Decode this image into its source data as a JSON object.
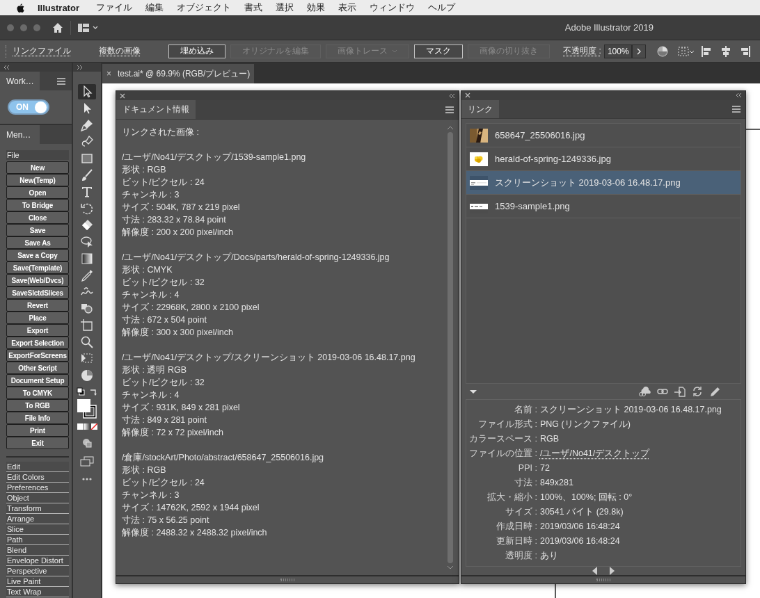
{
  "menubar": {
    "app": "Illustrator",
    "menus": [
      "ファイル",
      "編集",
      "オブジェクト",
      "書式",
      "選択",
      "効果",
      "表示",
      "ウィンドウ",
      "ヘルプ"
    ]
  },
  "window": {
    "title": "Adobe Illustrator 2019"
  },
  "control_bar": {
    "items": [
      {
        "kind": "link",
        "label": "リンクファイル"
      },
      {
        "kind": "link",
        "label": "複数の画像"
      },
      {
        "kind": "button",
        "label": "埋め込み",
        "disabled": false
      },
      {
        "kind": "button",
        "label": "オリジナルを編集",
        "disabled": true
      },
      {
        "kind": "dropdown",
        "label": "画像トレース",
        "disabled": true
      },
      {
        "kind": "button",
        "label": "マスク",
        "disabled": false
      },
      {
        "kind": "button",
        "label": "画像の切り抜き",
        "disabled": true
      },
      {
        "kind": "link",
        "label": "不透明度 :"
      },
      {
        "kind": "field",
        "label": "100%"
      }
    ]
  },
  "workspace_panel": {
    "tab": "Work…",
    "toggle": {
      "label": "ON",
      "on": true
    }
  },
  "menu_panel": {
    "tab": "Men…",
    "section": "File",
    "buttons": [
      "New",
      "New(Temp)",
      "Open",
      "To Bridge",
      "Close",
      "Save",
      "Save As",
      "Save a Copy",
      "Save(Template)",
      "Save(Web/Dvcs)",
      "SaveSlctdSlices",
      "Revert",
      "Place",
      "Export",
      "Export Selection",
      "ExportForScreens",
      "Other Script",
      "Document Setup",
      "To CMYK",
      "To RGB",
      "File Info",
      "Print",
      "Exit"
    ],
    "items": [
      "Edit",
      "Edit Colors",
      "Preferences",
      "Object",
      "Transform",
      "Arrange",
      "Slice",
      "Path",
      "Blend",
      "Envelope Distort",
      "Perspective",
      "Live Paint",
      "Text Wrap"
    ]
  },
  "tools": [
    {
      "kind": "selection",
      "selected": true
    },
    {
      "kind": "direct",
      "selected": false
    },
    {
      "kind": "pen",
      "selected": false
    },
    {
      "kind": "curvature",
      "selected": false
    },
    {
      "kind": "rectangle",
      "selected": false
    },
    {
      "kind": "brush",
      "selected": false
    },
    {
      "kind": "type",
      "selected": false
    },
    {
      "kind": "rotate",
      "selected": false
    },
    {
      "kind": "eraser",
      "selected": false
    },
    {
      "kind": "bubble",
      "selected": false
    },
    {
      "kind": "gradient",
      "selected": false
    },
    {
      "kind": "eyedropper",
      "selected": false
    },
    {
      "kind": "squiggle",
      "selected": false
    },
    {
      "kind": "shapebuilder",
      "selected": false
    },
    {
      "kind": "artboard",
      "selected": false
    },
    {
      "kind": "zoom",
      "selected": false
    },
    {
      "kind": "transform",
      "selected": false
    },
    {
      "kind": "pie",
      "selected": false
    }
  ],
  "document_tab": {
    "close": "×",
    "label": "test.ai* @ 69.9% (RGB/プレビュー)"
  },
  "doc_info": {
    "tab": "ドキュメント情報",
    "heading": "リンクされた画像 :",
    "blocks": [
      {
        "path": "/ユーザ/No41/デスクトップ/1539-sample1.png",
        "lines": [
          "形状 : RGB",
          "ビット/ピクセル : 24",
          "チャンネル : 3",
          "サイズ : 504K, 787 x 219 pixel",
          "寸法 : 283.32 x 78.84 point",
          "解像度 : 200 x 200 pixel/inch"
        ]
      },
      {
        "path": "/ユーザ/No41/デスクトップ/Docs/parts/herald-of-spring-1249336.jpg",
        "lines": [
          "形状 : CMYK",
          "ビット/ピクセル : 32",
          "チャンネル : 4",
          "サイズ : 22968K, 2800 x 2100 pixel",
          "寸法 : 672 x 504 point",
          "解像度 : 300 x 300 pixel/inch"
        ]
      },
      {
        "path": "/ユーザ/No41/デスクトップ/スクリーンショット 2019-03-06 16.48.17.png",
        "lines": [
          "形状 : 透明 RGB",
          "ビット/ピクセル : 32",
          "チャンネル : 4",
          "サイズ : 931K, 849 x 281 pixel",
          "寸法 : 849 x 281 point",
          "解像度 : 72 x 72 pixel/inch"
        ]
      },
      {
        "path": "/倉庫/stockArt/Photo/abstract/658647_25506016.jpg",
        "lines": [
          "形状 : RGB",
          "ビット/ピクセル : 24",
          "チャンネル : 3",
          "サイズ : 14762K, 2592 x 1944 pixel",
          "寸法 : 75 x 56.25 point",
          "解像度 : 2488.32 x 2488.32 pixel/inch"
        ]
      }
    ]
  },
  "links": {
    "tab": "リンク",
    "items": [
      {
        "name": "658647_25506016.jpg",
        "selected": false
      },
      {
        "name": "herald-of-spring-1249336.jpg",
        "selected": false
      },
      {
        "name": "スクリーンショット 2019-03-06 16.48.17.png",
        "selected": true
      },
      {
        "name": "1539-sample1.png",
        "selected": false
      }
    ],
    "details": [
      {
        "kind": "text",
        "label": "名前 :",
        "value": "スクリーンショット 2019-03-06 16.48.17.png"
      },
      {
        "kind": "text",
        "label": "ファイル形式 :",
        "value": "PNG (リンクファイル)"
      },
      {
        "kind": "text",
        "label": "カラースペース :",
        "value": "RGB"
      },
      {
        "kind": "link",
        "label": "ファイルの位置 :",
        "value": "/ユーザ/No41/デスクトップ"
      },
      {
        "kind": "text",
        "label": "PPI :",
        "value": "72"
      },
      {
        "kind": "text",
        "label": "寸法 :",
        "value": "849x281"
      },
      {
        "kind": "text",
        "label": "拡大・縮小 :",
        "value": "100%、100%; 回転 : 0°"
      },
      {
        "kind": "text",
        "label": "サイズ :",
        "value": "30541 バイト (29.8k)"
      },
      {
        "kind": "text",
        "label": "作成日時 :",
        "value": "2019/03/06 16:48:24"
      },
      {
        "kind": "text",
        "label": "更新日時 :",
        "value": "2019/03/06 16:48:24"
      },
      {
        "kind": "text",
        "label": "透明度 :",
        "value": "あり"
      }
    ]
  }
}
